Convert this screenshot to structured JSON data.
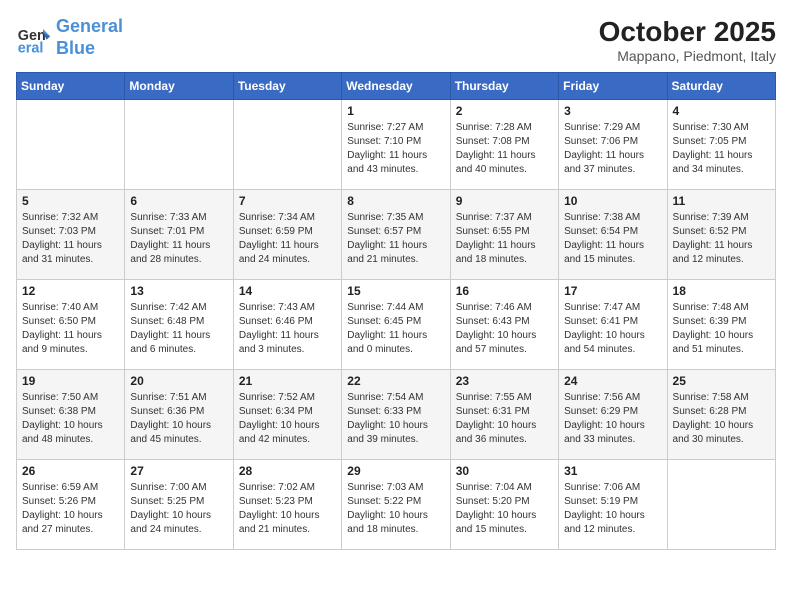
{
  "header": {
    "logo_line1": "General",
    "logo_line2": "Blue",
    "title": "October 2025",
    "subtitle": "Mappano, Piedmont, Italy"
  },
  "days_of_week": [
    "Sunday",
    "Monday",
    "Tuesday",
    "Wednesday",
    "Thursday",
    "Friday",
    "Saturday"
  ],
  "weeks": [
    [
      {
        "day": "",
        "info": ""
      },
      {
        "day": "",
        "info": ""
      },
      {
        "day": "",
        "info": ""
      },
      {
        "day": "1",
        "info": "Sunrise: 7:27 AM\nSunset: 7:10 PM\nDaylight: 11 hours and 43 minutes."
      },
      {
        "day": "2",
        "info": "Sunrise: 7:28 AM\nSunset: 7:08 PM\nDaylight: 11 hours and 40 minutes."
      },
      {
        "day": "3",
        "info": "Sunrise: 7:29 AM\nSunset: 7:06 PM\nDaylight: 11 hours and 37 minutes."
      },
      {
        "day": "4",
        "info": "Sunrise: 7:30 AM\nSunset: 7:05 PM\nDaylight: 11 hours and 34 minutes."
      }
    ],
    [
      {
        "day": "5",
        "info": "Sunrise: 7:32 AM\nSunset: 7:03 PM\nDaylight: 11 hours and 31 minutes."
      },
      {
        "day": "6",
        "info": "Sunrise: 7:33 AM\nSunset: 7:01 PM\nDaylight: 11 hours and 28 minutes."
      },
      {
        "day": "7",
        "info": "Sunrise: 7:34 AM\nSunset: 6:59 PM\nDaylight: 11 hours and 24 minutes."
      },
      {
        "day": "8",
        "info": "Sunrise: 7:35 AM\nSunset: 6:57 PM\nDaylight: 11 hours and 21 minutes."
      },
      {
        "day": "9",
        "info": "Sunrise: 7:37 AM\nSunset: 6:55 PM\nDaylight: 11 hours and 18 minutes."
      },
      {
        "day": "10",
        "info": "Sunrise: 7:38 AM\nSunset: 6:54 PM\nDaylight: 11 hours and 15 minutes."
      },
      {
        "day": "11",
        "info": "Sunrise: 7:39 AM\nSunset: 6:52 PM\nDaylight: 11 hours and 12 minutes."
      }
    ],
    [
      {
        "day": "12",
        "info": "Sunrise: 7:40 AM\nSunset: 6:50 PM\nDaylight: 11 hours and 9 minutes."
      },
      {
        "day": "13",
        "info": "Sunrise: 7:42 AM\nSunset: 6:48 PM\nDaylight: 11 hours and 6 minutes."
      },
      {
        "day": "14",
        "info": "Sunrise: 7:43 AM\nSunset: 6:46 PM\nDaylight: 11 hours and 3 minutes."
      },
      {
        "day": "15",
        "info": "Sunrise: 7:44 AM\nSunset: 6:45 PM\nDaylight: 11 hours and 0 minutes."
      },
      {
        "day": "16",
        "info": "Sunrise: 7:46 AM\nSunset: 6:43 PM\nDaylight: 10 hours and 57 minutes."
      },
      {
        "day": "17",
        "info": "Sunrise: 7:47 AM\nSunset: 6:41 PM\nDaylight: 10 hours and 54 minutes."
      },
      {
        "day": "18",
        "info": "Sunrise: 7:48 AM\nSunset: 6:39 PM\nDaylight: 10 hours and 51 minutes."
      }
    ],
    [
      {
        "day": "19",
        "info": "Sunrise: 7:50 AM\nSunset: 6:38 PM\nDaylight: 10 hours and 48 minutes."
      },
      {
        "day": "20",
        "info": "Sunrise: 7:51 AM\nSunset: 6:36 PM\nDaylight: 10 hours and 45 minutes."
      },
      {
        "day": "21",
        "info": "Sunrise: 7:52 AM\nSunset: 6:34 PM\nDaylight: 10 hours and 42 minutes."
      },
      {
        "day": "22",
        "info": "Sunrise: 7:54 AM\nSunset: 6:33 PM\nDaylight: 10 hours and 39 minutes."
      },
      {
        "day": "23",
        "info": "Sunrise: 7:55 AM\nSunset: 6:31 PM\nDaylight: 10 hours and 36 minutes."
      },
      {
        "day": "24",
        "info": "Sunrise: 7:56 AM\nSunset: 6:29 PM\nDaylight: 10 hours and 33 minutes."
      },
      {
        "day": "25",
        "info": "Sunrise: 7:58 AM\nSunset: 6:28 PM\nDaylight: 10 hours and 30 minutes."
      }
    ],
    [
      {
        "day": "26",
        "info": "Sunrise: 6:59 AM\nSunset: 5:26 PM\nDaylight: 10 hours and 27 minutes."
      },
      {
        "day": "27",
        "info": "Sunrise: 7:00 AM\nSunset: 5:25 PM\nDaylight: 10 hours and 24 minutes."
      },
      {
        "day": "28",
        "info": "Sunrise: 7:02 AM\nSunset: 5:23 PM\nDaylight: 10 hours and 21 minutes."
      },
      {
        "day": "29",
        "info": "Sunrise: 7:03 AM\nSunset: 5:22 PM\nDaylight: 10 hours and 18 minutes."
      },
      {
        "day": "30",
        "info": "Sunrise: 7:04 AM\nSunset: 5:20 PM\nDaylight: 10 hours and 15 minutes."
      },
      {
        "day": "31",
        "info": "Sunrise: 7:06 AM\nSunset: 5:19 PM\nDaylight: 10 hours and 12 minutes."
      },
      {
        "day": "",
        "info": ""
      }
    ]
  ]
}
